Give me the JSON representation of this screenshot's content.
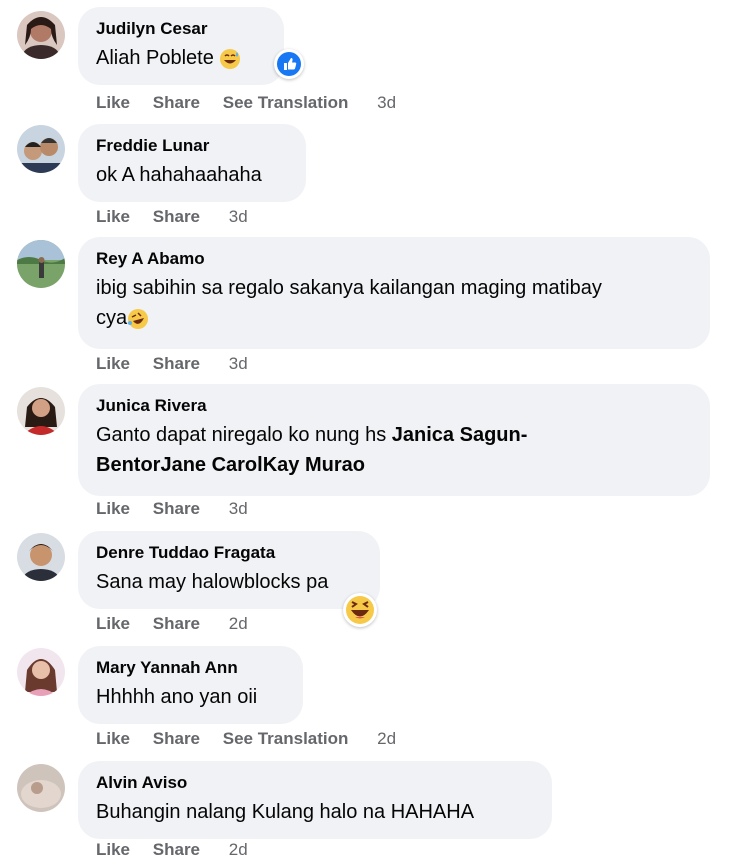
{
  "actions": {
    "like": "Like",
    "share": "Share",
    "see_translation": "See Translation"
  },
  "comments": [
    {
      "name": "Judilyn Cesar",
      "text": "Aliah Poblete",
      "time": "3d",
      "emoji": "grinning-sweat-icon",
      "reaction": "like-icon"
    },
    {
      "name": "Freddie Lunar",
      "text": "ok A hahahaahaha",
      "time": "3d"
    },
    {
      "name": "Rey A Abamo",
      "text_line1": "ibig sabihin sa regalo sakanya kailangan maging matibay",
      "text_line2": "cya",
      "time": "3d",
      "emoji": "rolling-laughing-icon"
    },
    {
      "name": "Junica Rivera",
      "text_prefix": "Ganto dapat niregalo ko nung hs ",
      "mention1": "Janica Sagun-",
      "mention2": "BentorJane CarolKay Murao",
      "time": "3d"
    },
    {
      "name": "Denre Tuddao Fragata",
      "text": "Sana may halowblocks pa",
      "time": "2d",
      "reaction": "haha-icon"
    },
    {
      "name": "Mary Yannah Ann",
      "text": "Hhhhh ano yan oii",
      "time": "2d"
    },
    {
      "name": "Alvin Aviso",
      "text": "Buhangin nalang Kulang halo na HAHAHA",
      "time": "2d"
    }
  ],
  "colors": {
    "bubble": "#f0f2f5",
    "meta": "#65676b",
    "like_blue": "#1877f2"
  }
}
